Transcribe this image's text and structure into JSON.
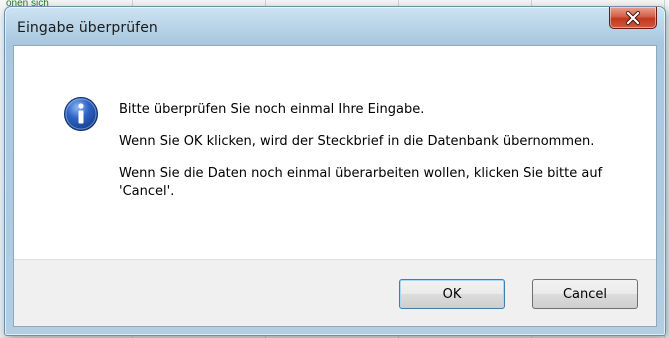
{
  "background": {
    "snippet": "onen sich"
  },
  "dialog": {
    "title": "Eingabe überprüfen",
    "close_icon": "close-icon",
    "message_icon": "information-icon",
    "message": {
      "line1": "Bitte überprüfen Sie noch einmal Ihre Eingabe.",
      "line2": "Wenn Sie OK klicken, wird der Steckbrief in die Datenbank übernommen.",
      "line3": "Wenn Sie die Daten noch einmal überarbeiten wollen, klicken Sie bitte auf 'Cancel'."
    },
    "buttons": {
      "ok_label": "OK",
      "cancel_label": "Cancel"
    }
  },
  "colors": {
    "close_button": "#c7432a",
    "info_icon": "#1f4fa5",
    "frame": "#b3cde1"
  }
}
